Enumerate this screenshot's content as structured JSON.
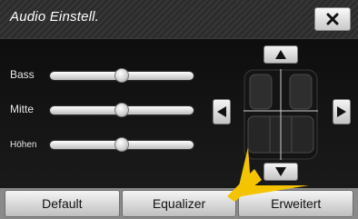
{
  "window": {
    "title": "Audio Einstell."
  },
  "sliders": [
    {
      "label": "Bass",
      "value": 0.5
    },
    {
      "label": "Mitte",
      "value": 0.5
    },
    {
      "label": "Höhen",
      "value": 0.5
    }
  ],
  "tabs": [
    {
      "label": "Default"
    },
    {
      "label": "Equalizer"
    },
    {
      "label": "Erweitert"
    }
  ],
  "icons": {
    "close": "close-icon",
    "up": "arrow-up-icon",
    "down": "arrow-down-icon",
    "left": "arrow-left-icon",
    "right": "arrow-right-icon",
    "seats": "car-seats-icon",
    "pointer": "pointer-arrow-icon"
  },
  "colors": {
    "pointer": "#f5c400"
  }
}
